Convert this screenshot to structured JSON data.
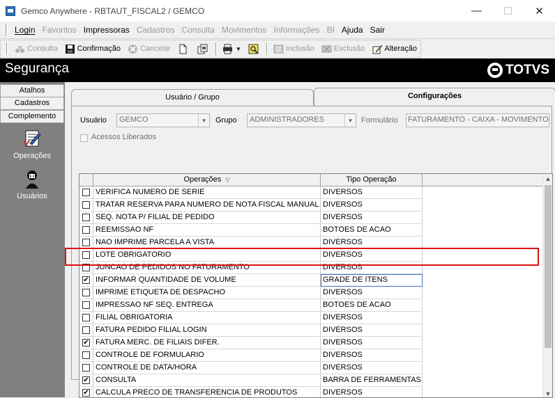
{
  "window": {
    "title": "Gemco Anywhere - RBTAUT_FISCAL2 / GEMCO"
  },
  "menu": [
    {
      "label": "Login",
      "enabled": true
    },
    {
      "label": "Favoritos",
      "enabled": false
    },
    {
      "label": "Impressoras",
      "enabled": true
    },
    {
      "label": "Cadastros",
      "enabled": false
    },
    {
      "label": "Consulta",
      "enabled": false
    },
    {
      "label": "Movimentos",
      "enabled": false
    },
    {
      "label": "Informações",
      "enabled": false
    },
    {
      "label": "BI",
      "enabled": false
    },
    {
      "label": "Ajuda",
      "enabled": true
    },
    {
      "label": "Sair",
      "enabled": true
    }
  ],
  "toolbar": {
    "consulta": "Consulta",
    "confirmacao": "Confirmação",
    "cancelar": "Cancelar",
    "inclusao": "Inclusão",
    "exclusao": "Exclusão",
    "alteracao": "Alteração"
  },
  "header": {
    "title": "Segurança",
    "logo": "TOTVS"
  },
  "sidebar": {
    "tabs": [
      "Atalhos",
      "Cadastros",
      "Complemento"
    ],
    "items": [
      {
        "label": "Operações",
        "icon": "operations-icon"
      },
      {
        "label": "Usuários",
        "icon": "users-icon"
      }
    ]
  },
  "tabs": {
    "usuario_grupo": "Usuário  / Grupo",
    "configuracoes": "Configurações"
  },
  "form": {
    "usuario_label": "Usuário",
    "usuario_value": "GEMCO",
    "grupo_label": "Grupo",
    "grupo_value": "ADMINISTRADORES",
    "formulario_label": "Formulário",
    "formulario_value": "FATURAMENTO - CAIXA - MOVIMENTOS",
    "acessos_label": "Acessos Liberados"
  },
  "grid": {
    "headers": {
      "operacoes": "Operações",
      "tipo": "Tipo Operação"
    },
    "rows": [
      {
        "checked": false,
        "op": "VERIFICA NUMERO DE SERIE",
        "tipo": "DIVERSOS"
      },
      {
        "checked": false,
        "op": "TRATAR RESERVA PARA NUMERO DE NOTA FISCAL MANUAL",
        "tipo": "DIVERSOS"
      },
      {
        "checked": false,
        "op": "SEQ. NOTA P/ FILIAL DE PEDIDO",
        "tipo": "DIVERSOS"
      },
      {
        "checked": false,
        "op": "REEMISSAO NF",
        "tipo": "BOTOES DE ACAO"
      },
      {
        "checked": false,
        "op": "NAO IMPRIME PARCELA A VISTA",
        "tipo": "DIVERSOS"
      },
      {
        "checked": false,
        "op": "LOTE OBRIGATORIO",
        "tipo": "DIVERSOS"
      },
      {
        "checked": false,
        "op": "JUNCAO DE PEDIDOS NO FATURAMENTO",
        "tipo": "DIVERSOS"
      },
      {
        "checked": true,
        "op": "INFORMAR QUANTIDADE DE VOLUME",
        "tipo": "GRADE DE ITENS",
        "selected": true
      },
      {
        "checked": false,
        "op": "IMPRIME ETIQUETA DE DESPACHO",
        "tipo": "DIVERSOS"
      },
      {
        "checked": false,
        "op": "IMPRESSAO NF SEQ. ENTREGA",
        "tipo": "BOTOES DE ACAO"
      },
      {
        "checked": false,
        "op": "FILIAL OBRIGATORIA",
        "tipo": "DIVERSOS"
      },
      {
        "checked": false,
        "op": "FATURA PEDIDO FILIAL LOGIN",
        "tipo": "DIVERSOS"
      },
      {
        "checked": true,
        "op": "FATURA MERC. DE FILIAIS DIFER.",
        "tipo": "DIVERSOS"
      },
      {
        "checked": false,
        "op": "CONTROLE DE FORMULARIO",
        "tipo": "DIVERSOS"
      },
      {
        "checked": false,
        "op": "CONTROLE DE DATA/HORA",
        "tipo": "DIVERSOS"
      },
      {
        "checked": true,
        "op": "CONSULTA",
        "tipo": "BARRA DE FERRAMENTAS"
      },
      {
        "checked": true,
        "op": "CALCULA PRECO DE TRANSFERENCIA DE PRODUTOS",
        "tipo": "DIVERSOS"
      }
    ]
  },
  "colors": {
    "highlight": "#e01010",
    "header_bg": "#000000",
    "sidebar_bg": "#808080"
  }
}
